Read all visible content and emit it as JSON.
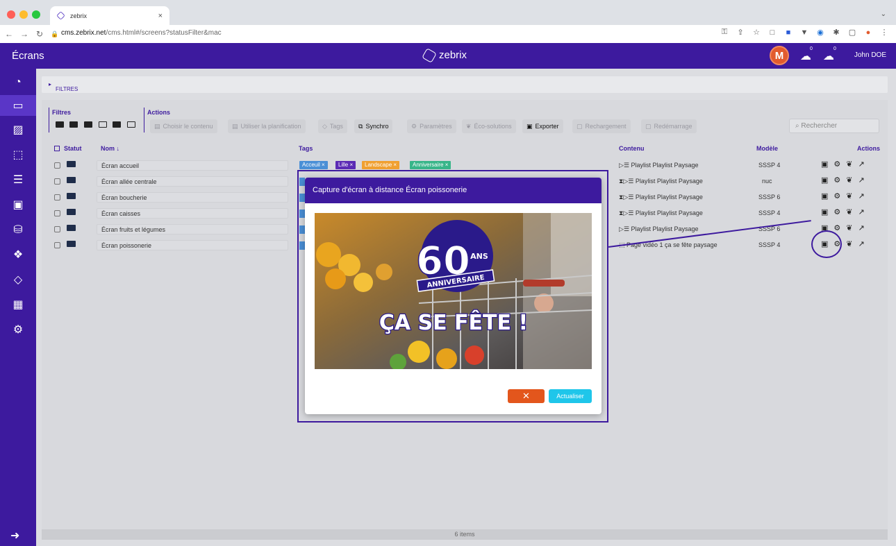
{
  "browser": {
    "tab_title": "zebrix",
    "tab_close": "×",
    "url_host": "cms.zebrix.net",
    "url_path": "/cms.html#/screens?statusFilter&mac"
  },
  "header": {
    "page_title": "Écrans",
    "brand": "zebrix",
    "avatar_letter": "M",
    "user_name": "John DOE",
    "cloud_badge_1": "0",
    "cloud_badge_2": "0"
  },
  "filters_bar": {
    "label": "FILTRES"
  },
  "toolbar": {
    "filters_label": "Filtres",
    "actions_label": "Actions",
    "buttons": [
      "Choisir le contenu",
      "Utiliser la planification",
      "Tags",
      "Synchro",
      "Paramètres",
      "Éco-solutions",
      "Exporter",
      "Rechargement",
      "Redémarrage"
    ],
    "search_placeholder": "Rechercher"
  },
  "table": {
    "headers": {
      "status": "Statut",
      "name": "Nom ↓",
      "tags": "Tags",
      "content": "Contenu",
      "model": "Modèle",
      "actions": "Actions"
    },
    "rows": [
      {
        "name": "Écran accueil",
        "content": "Playlist Playlist Paysage",
        "model": "SSSP 4"
      },
      {
        "name": "Écran allée centrale",
        "content": "Playlist Playlist Paysage",
        "model": "nuc"
      },
      {
        "name": "Écran boucherie",
        "content": "Playlist Playlist Paysage",
        "model": "SSSP 6"
      },
      {
        "name": "Écran caisses",
        "content": "Playlist Playlist Paysage",
        "model": "SSSP 4"
      },
      {
        "name": "Écran fruits et légumes",
        "content": "Playlist Playlist Paysage",
        "model": "SSSP 6"
      },
      {
        "name": "Écran poissonerie",
        "content": "Page vidéo 1 ça se fête paysage",
        "model": "SSSP 4"
      }
    ],
    "row1_tags": [
      {
        "label": "Acceuil ×",
        "color": "#4a8fd6"
      },
      {
        "label": "Lille ×",
        "color": "#5b2bb5"
      },
      {
        "label": "Landscape ×",
        "color": "#f0a030"
      },
      {
        "label": "Anniversaire ×",
        "color": "#38b589"
      }
    ]
  },
  "footer": {
    "count": "6 items"
  },
  "modal": {
    "title": "Capture d'écran à distance Écran poissonerie",
    "image": {
      "line1": "60",
      "line1_small": "ANS",
      "line2": "ANNIVERSAIRE",
      "line3": "ÇA SE FÊTE !"
    },
    "close_label": "✕",
    "refresh_label": "Actualiser"
  }
}
